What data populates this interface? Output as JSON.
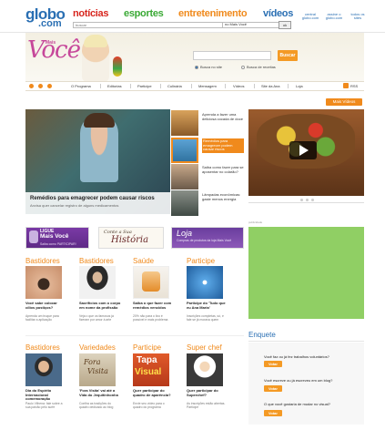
{
  "globo": {
    "logo_top": "globo",
    "logo_bottom": ".com",
    "nav": [
      {
        "label": "notícias",
        "color": "#d7261e"
      },
      {
        "label": "esportes",
        "color": "#3aa935"
      },
      {
        "label": "entretenimento",
        "color": "#f08a1c"
      },
      {
        "label": "vídeos",
        "color": "#2a6fb3"
      }
    ],
    "search_placeholder": "buscar",
    "scope": "no Mais Você",
    "ok": "ok",
    "links": [
      {
        "l1": "central",
        "l2": "globo.com"
      },
      {
        "l1": "assine o",
        "l2": "globo.com"
      },
      {
        "l1": "todos os",
        "l2": "sites"
      }
    ]
  },
  "header": {
    "logo": "Você",
    "logo_small": "Mais",
    "search_button": "Buscar",
    "radio_site": "Busca no site",
    "radio_recipes": "Busca de receitas"
  },
  "menu": {
    "items": [
      "O Programa",
      "Editorias",
      "Participe",
      "Culinária",
      "Mensagem",
      "Vídeos",
      "Site da Ana",
      "Loja"
    ],
    "rss": "RSS"
  },
  "featured": {
    "more_videos": "Mais Vídeos",
    "title": "Remédios para emagrecer podem causar riscos",
    "subtitle": "Anvisa quer cancelar registro de alguns medicamentos",
    "thumbs": [
      {
        "caption": "Aprenda a fazer uma deliciosa cocada de doce"
      },
      {
        "caption": "Remédios para emagrecer podem causar riscos"
      },
      {
        "caption": "Saiba como fazer para se aposentar no colarão?"
      },
      {
        "caption": "Lâmpadas econômicas: gaste menos energia"
      }
    ]
  },
  "banners": {
    "ligue_top": "LIGUE",
    "ligue_main": "Mais Você",
    "ligue_sub": "Saiba como PARTICIPAR!",
    "historia_a": "Conte a Sua",
    "historia_b": "História",
    "loja_main": "Loja",
    "loja_sub": "Compras de produtos da loja Mais Você",
    "ad_label": "publicidade"
  },
  "row1": [
    {
      "section": "Bastidores",
      "title": "Você sabe colocar cílios postiços?",
      "sub": "Aprenda um truque para facilitar a aplicação"
    },
    {
      "section": "Bastidores",
      "title": "Sacrifícios com o corpo em nome da profissão",
      "sub": "Veja o que os famosos já fizeram por amor à arte"
    },
    {
      "section": "Saúde",
      "title": "Saiba o que fazer com remédios vencidos",
      "sub": "20% não para o lixo é possível e mais problema"
    },
    {
      "section": "Participe",
      "title": "Participe do 'Tudo que eu Ana Maria'",
      "sub": "Inscrições completas, só, e fale se já morava quem"
    }
  ],
  "row2": [
    {
      "section": "Bastidores",
      "title": "Dia do Espírito Internacional comemoração",
      "sub": "Paulo Vilhena: fale sobre a sua paixão pelo surfe"
    },
    {
      "section": "Variedades",
      "title": "'Fora Visita' vai até a Vida do Jequitinhonha",
      "sub": "Confira as tradições do quadro dedicado ao blog"
    },
    {
      "section": "Participe",
      "title": "Quer participar do quadro de aparência?",
      "sub": "Envie seu vídeo para o quadro do programa"
    },
    {
      "section": "Super chef",
      "title": "Quer participar do Superchef?",
      "sub": "As inscrições estão abertas. Participe"
    }
  ],
  "row2_img_text": {
    "fora": "Fora",
    "visita": "Visita",
    "tapa": "Tapa",
    "visual": "Visual"
  },
  "enquete": {
    "title": "Enquete",
    "questions": [
      "Você faz ou já fez trabalhos voluntários?",
      "Você escreve ou já escreveu em um blog?",
      "O que você gostaria de mudar no visual?"
    ],
    "vote": "Votar"
  }
}
